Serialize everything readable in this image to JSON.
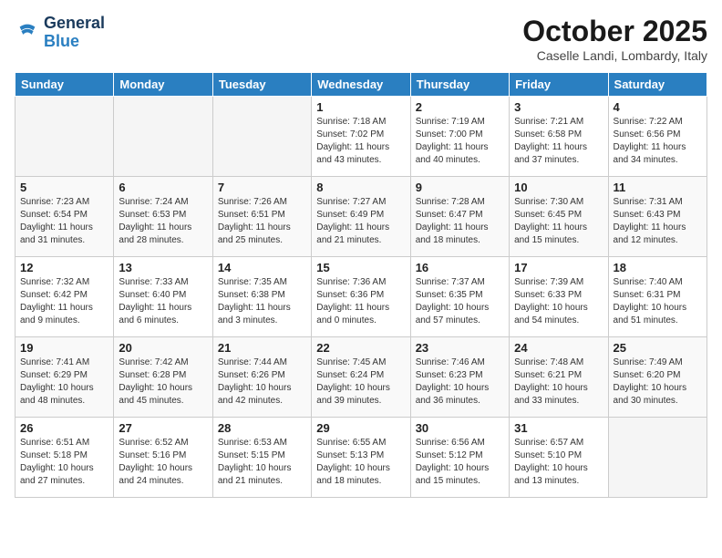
{
  "header": {
    "logo_line1": "General",
    "logo_line2": "Blue",
    "title": "October 2025",
    "subtitle": "Caselle Landi, Lombardy, Italy"
  },
  "days_of_week": [
    "Sunday",
    "Monday",
    "Tuesday",
    "Wednesday",
    "Thursday",
    "Friday",
    "Saturday"
  ],
  "weeks": [
    [
      {
        "num": "",
        "info": ""
      },
      {
        "num": "",
        "info": ""
      },
      {
        "num": "",
        "info": ""
      },
      {
        "num": "1",
        "info": "Sunrise: 7:18 AM\nSunset: 7:02 PM\nDaylight: 11 hours\nand 43 minutes."
      },
      {
        "num": "2",
        "info": "Sunrise: 7:19 AM\nSunset: 7:00 PM\nDaylight: 11 hours\nand 40 minutes."
      },
      {
        "num": "3",
        "info": "Sunrise: 7:21 AM\nSunset: 6:58 PM\nDaylight: 11 hours\nand 37 minutes."
      },
      {
        "num": "4",
        "info": "Sunrise: 7:22 AM\nSunset: 6:56 PM\nDaylight: 11 hours\nand 34 minutes."
      }
    ],
    [
      {
        "num": "5",
        "info": "Sunrise: 7:23 AM\nSunset: 6:54 PM\nDaylight: 11 hours\nand 31 minutes."
      },
      {
        "num": "6",
        "info": "Sunrise: 7:24 AM\nSunset: 6:53 PM\nDaylight: 11 hours\nand 28 minutes."
      },
      {
        "num": "7",
        "info": "Sunrise: 7:26 AM\nSunset: 6:51 PM\nDaylight: 11 hours\nand 25 minutes."
      },
      {
        "num": "8",
        "info": "Sunrise: 7:27 AM\nSunset: 6:49 PM\nDaylight: 11 hours\nand 21 minutes."
      },
      {
        "num": "9",
        "info": "Sunrise: 7:28 AM\nSunset: 6:47 PM\nDaylight: 11 hours\nand 18 minutes."
      },
      {
        "num": "10",
        "info": "Sunrise: 7:30 AM\nSunset: 6:45 PM\nDaylight: 11 hours\nand 15 minutes."
      },
      {
        "num": "11",
        "info": "Sunrise: 7:31 AM\nSunset: 6:43 PM\nDaylight: 11 hours\nand 12 minutes."
      }
    ],
    [
      {
        "num": "12",
        "info": "Sunrise: 7:32 AM\nSunset: 6:42 PM\nDaylight: 11 hours\nand 9 minutes."
      },
      {
        "num": "13",
        "info": "Sunrise: 7:33 AM\nSunset: 6:40 PM\nDaylight: 11 hours\nand 6 minutes."
      },
      {
        "num": "14",
        "info": "Sunrise: 7:35 AM\nSunset: 6:38 PM\nDaylight: 11 hours\nand 3 minutes."
      },
      {
        "num": "15",
        "info": "Sunrise: 7:36 AM\nSunset: 6:36 PM\nDaylight: 11 hours\nand 0 minutes."
      },
      {
        "num": "16",
        "info": "Sunrise: 7:37 AM\nSunset: 6:35 PM\nDaylight: 10 hours\nand 57 minutes."
      },
      {
        "num": "17",
        "info": "Sunrise: 7:39 AM\nSunset: 6:33 PM\nDaylight: 10 hours\nand 54 minutes."
      },
      {
        "num": "18",
        "info": "Sunrise: 7:40 AM\nSunset: 6:31 PM\nDaylight: 10 hours\nand 51 minutes."
      }
    ],
    [
      {
        "num": "19",
        "info": "Sunrise: 7:41 AM\nSunset: 6:29 PM\nDaylight: 10 hours\nand 48 minutes."
      },
      {
        "num": "20",
        "info": "Sunrise: 7:42 AM\nSunset: 6:28 PM\nDaylight: 10 hours\nand 45 minutes."
      },
      {
        "num": "21",
        "info": "Sunrise: 7:44 AM\nSunset: 6:26 PM\nDaylight: 10 hours\nand 42 minutes."
      },
      {
        "num": "22",
        "info": "Sunrise: 7:45 AM\nSunset: 6:24 PM\nDaylight: 10 hours\nand 39 minutes."
      },
      {
        "num": "23",
        "info": "Sunrise: 7:46 AM\nSunset: 6:23 PM\nDaylight: 10 hours\nand 36 minutes."
      },
      {
        "num": "24",
        "info": "Sunrise: 7:48 AM\nSunset: 6:21 PM\nDaylight: 10 hours\nand 33 minutes."
      },
      {
        "num": "25",
        "info": "Sunrise: 7:49 AM\nSunset: 6:20 PM\nDaylight: 10 hours\nand 30 minutes."
      }
    ],
    [
      {
        "num": "26",
        "info": "Sunrise: 6:51 AM\nSunset: 5:18 PM\nDaylight: 10 hours\nand 27 minutes."
      },
      {
        "num": "27",
        "info": "Sunrise: 6:52 AM\nSunset: 5:16 PM\nDaylight: 10 hours\nand 24 minutes."
      },
      {
        "num": "28",
        "info": "Sunrise: 6:53 AM\nSunset: 5:15 PM\nDaylight: 10 hours\nand 21 minutes."
      },
      {
        "num": "29",
        "info": "Sunrise: 6:55 AM\nSunset: 5:13 PM\nDaylight: 10 hours\nand 18 minutes."
      },
      {
        "num": "30",
        "info": "Sunrise: 6:56 AM\nSunset: 5:12 PM\nDaylight: 10 hours\nand 15 minutes."
      },
      {
        "num": "31",
        "info": "Sunrise: 6:57 AM\nSunset: 5:10 PM\nDaylight: 10 hours\nand 13 minutes."
      },
      {
        "num": "",
        "info": ""
      }
    ]
  ],
  "colors": {
    "header_bg": "#2a7fc1",
    "logo_dark": "#1a3a5c",
    "logo_blue": "#2a7fc1",
    "empty_bg": "#f5f5f5",
    "shade_bg": "#f9f9f9"
  }
}
